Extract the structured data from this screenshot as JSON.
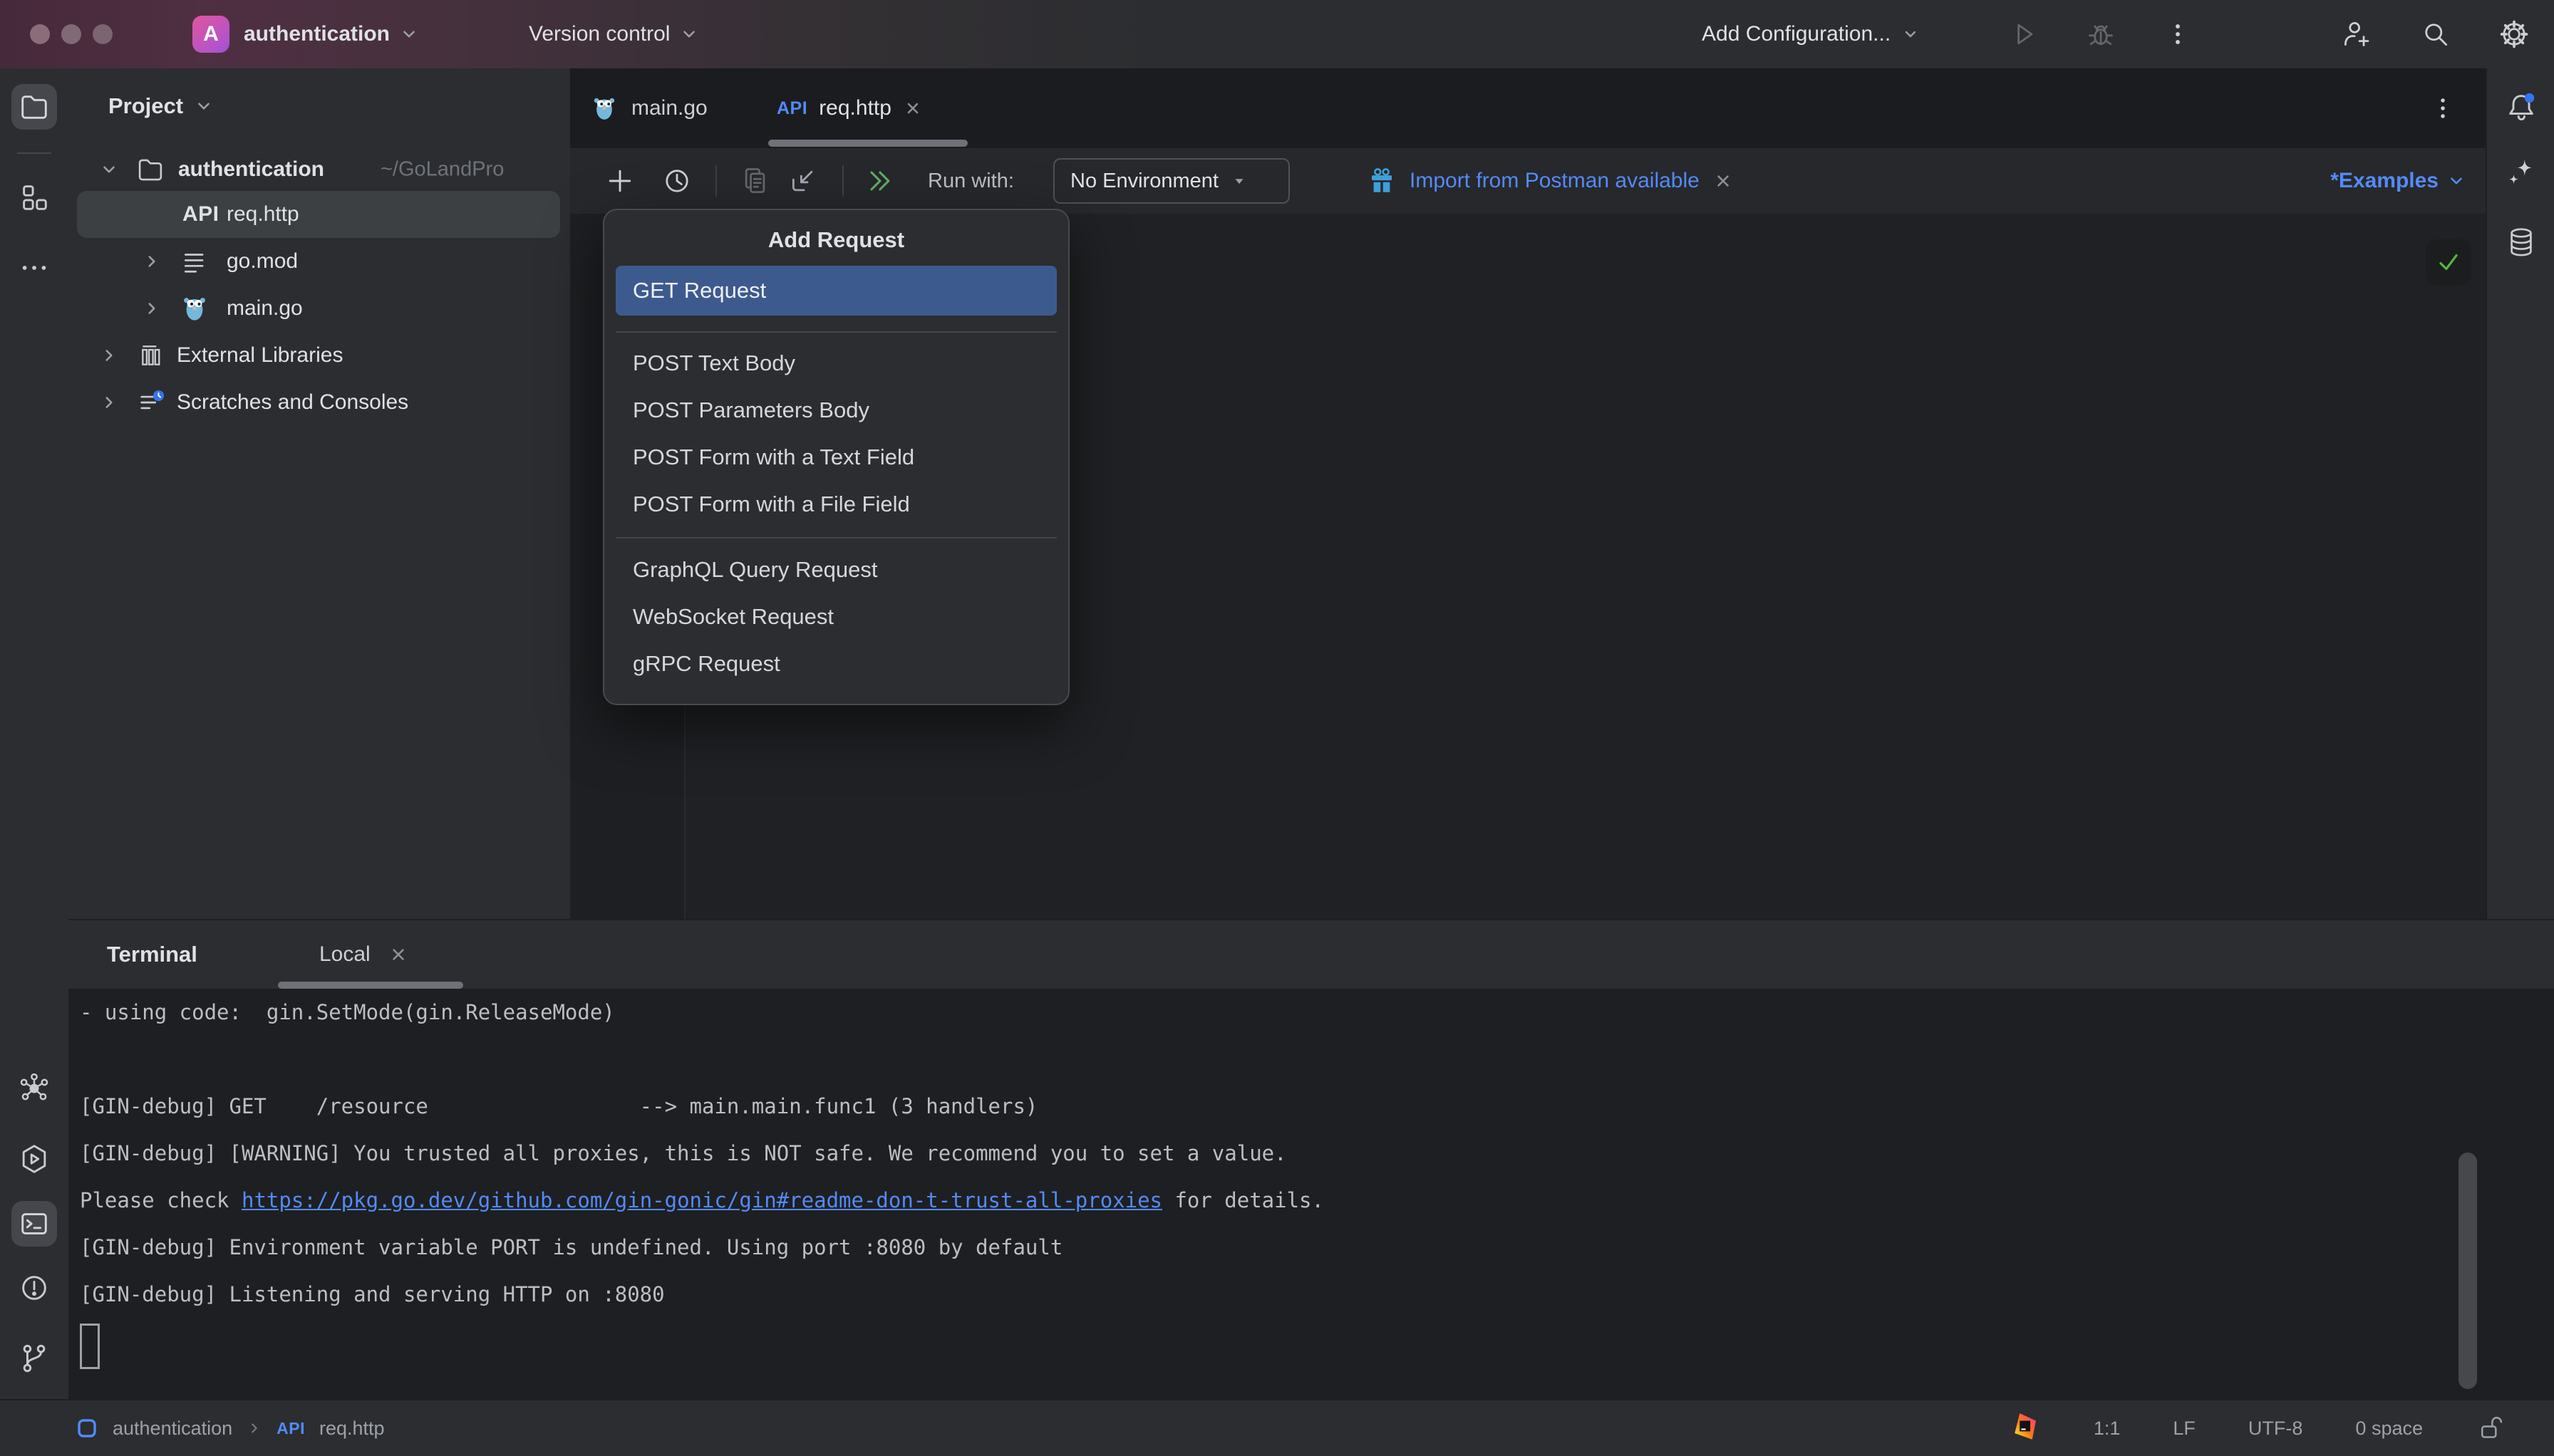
{
  "titlebar": {
    "project_initial": "A",
    "project_name": "authentication",
    "vcs": "Version control",
    "run_config": "Add Configuration..."
  },
  "project": {
    "header": "Project",
    "tree": {
      "root": {
        "label": "authentication",
        "path": "~/GoLandPro"
      },
      "req": {
        "badge": "API",
        "label": "req.http"
      },
      "gomod": {
        "label": "go.mod"
      },
      "maingo": {
        "label": "main.go"
      },
      "external": {
        "label": "External Libraries"
      },
      "scratches": {
        "label": "Scratches and Consoles"
      }
    }
  },
  "tabs": {
    "main": {
      "label": "main.go"
    },
    "req": {
      "badge": "API",
      "label": "req.http"
    }
  },
  "http_toolbar": {
    "run_with": "Run with:",
    "environment": "No Environment",
    "notification": "Import from Postman available",
    "examples": "*Examples"
  },
  "popup": {
    "title": "Add Request",
    "items": [
      "GET Request",
      "POST Text Body",
      "POST Parameters Body",
      "POST Form with a Text Field",
      "POST Form with a File Field",
      "GraphQL Query Request",
      "WebSocket Request",
      "gRPC Request"
    ]
  },
  "terminal": {
    "title": "Terminal",
    "tab": "Local",
    "lines": {
      "l1": "- using code:  gin.SetMode(gin.ReleaseMode)",
      "l3": "[GIN-debug] GET    /resource                 --> main.main.func1 (3 handlers)",
      "l4": "[GIN-debug] [WARNING] You trusted all proxies, this is NOT safe. We recommend you to set a value.",
      "l5_prefix": "Please check ",
      "l5_link": "https://pkg.go.dev/github.com/gin-gonic/gin#readme-don-t-trust-all-proxies",
      "l5_suffix": " for details.",
      "l6": "[GIN-debug] Environment variable PORT is undefined. Using port :8080 by default",
      "l7": "[GIN-debug] Listening and serving HTTP on :8080"
    }
  },
  "statusbar": {
    "project": "authentication",
    "file_badge": "API",
    "file": "req.http",
    "caret": "1:1",
    "line_sep": "LF",
    "encoding": "UTF-8",
    "indent": "0 space"
  },
  "colors": {
    "accent": "#548af7",
    "selection": "#3d5a8e",
    "run_green": "#5fad65",
    "check_green": "#57b63f",
    "notification_blue": "#3f9fd8"
  }
}
